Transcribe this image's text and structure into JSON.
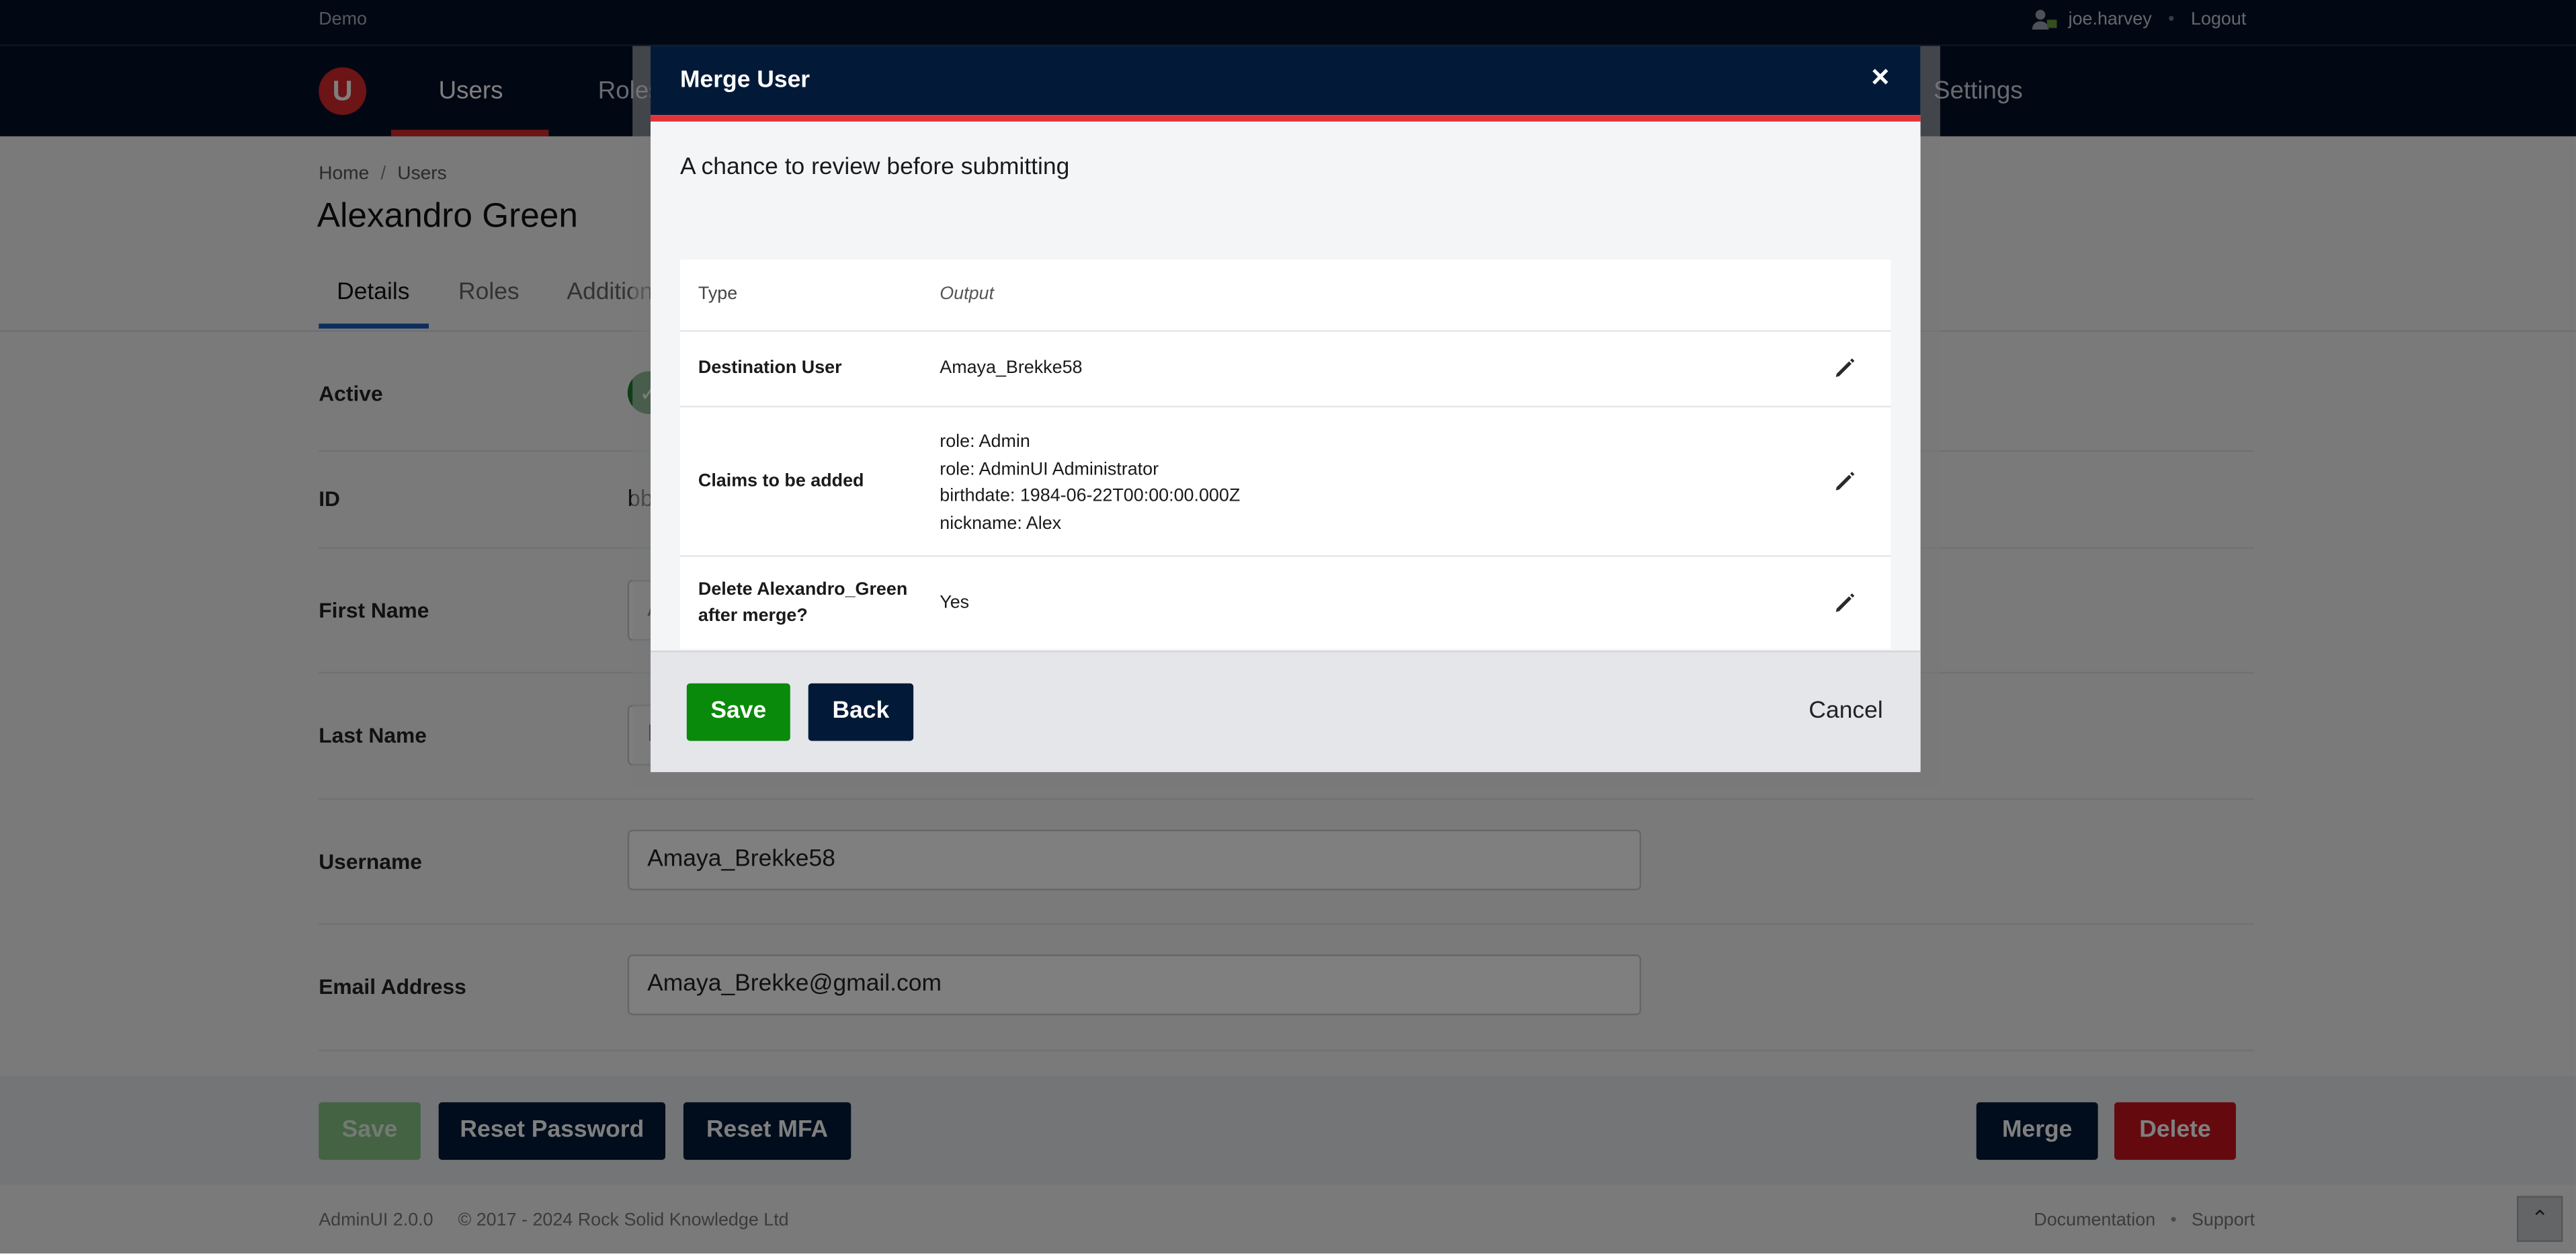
{
  "topbar": {
    "env": "Demo",
    "username": "joe.harvey",
    "logout": "Logout"
  },
  "nav": {
    "logo": "U",
    "items": [
      "Users",
      "Roles",
      "Settings"
    ]
  },
  "breadcrumb": [
    "Home",
    "Users"
  ],
  "page": {
    "title": "Alexandro Green",
    "tabs": [
      "Details",
      "Roles",
      "Addition"
    ]
  },
  "form": {
    "active_label": "Active",
    "id_label": "ID",
    "id_value": "bb",
    "first_name_label": "First Name",
    "first_name_value": "A",
    "last_name_label": "Last Name",
    "last_name_value": "B",
    "username_label": "Username",
    "username_value": "Amaya_Brekke58",
    "email_label": "Email Address",
    "email_value": "Amaya_Brekke@gmail.com"
  },
  "actions": {
    "save": "Save",
    "reset_password": "Reset Password",
    "reset_mfa": "Reset MFA",
    "merge": "Merge",
    "delete": "Delete"
  },
  "footer": {
    "version": "AdminUI 2.0.0",
    "copyright": "© 2017 - 2024 Rock Solid Knowledge Ltd",
    "documentation": "Documentation",
    "support": "Support",
    "scroll_top_icon": "chevron-up-icon"
  },
  "modal": {
    "title": "Merge User",
    "close": "×",
    "subtitle": "A chance to review before submitting",
    "header": {
      "type": "Type",
      "output": "Output"
    },
    "rows": [
      {
        "type": "Destination User",
        "output": [
          "Amaya_Brekke58"
        ]
      },
      {
        "type": "Claims to be added",
        "output": [
          "role: Admin",
          "role: AdminUI Administrator",
          "birthdate: 1984-06-22T00:00:00.000Z",
          "nickname: Alex"
        ]
      },
      {
        "type": "Delete Alexandro_Green after merge?",
        "output": [
          "Yes"
        ]
      }
    ],
    "save": "Save",
    "back": "Back",
    "cancel": "Cancel"
  },
  "colors": {
    "navy": "#021a38",
    "brand_red": "#d8282c",
    "save_green": "#0a8a0a",
    "delete_red": "#c8141e"
  }
}
